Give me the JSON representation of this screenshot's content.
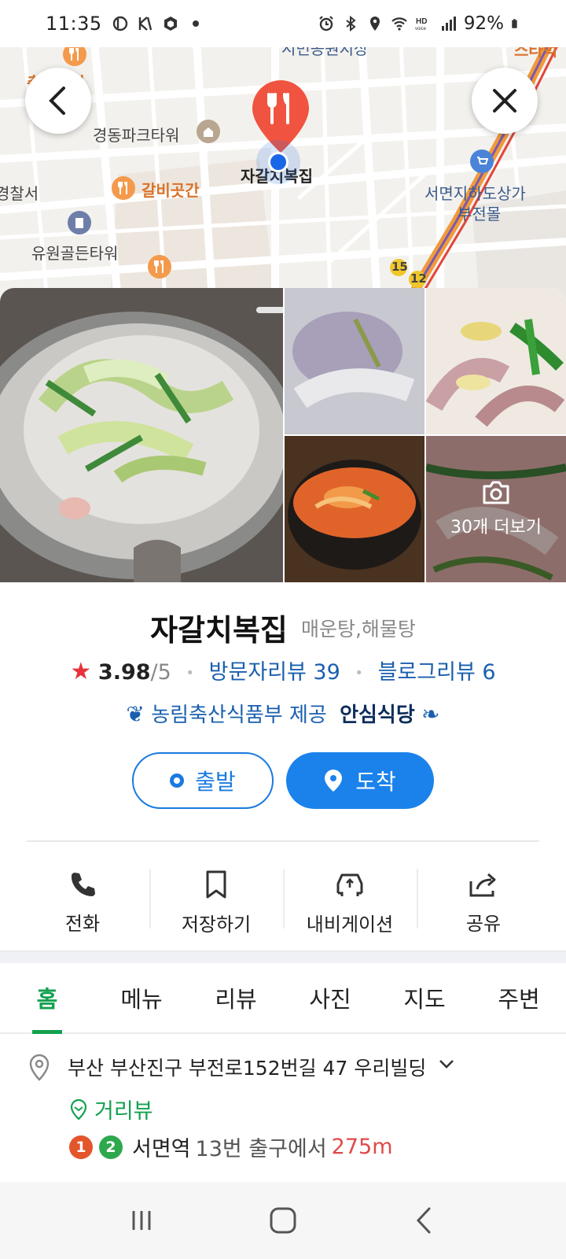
{
  "status_bar": {
    "time": "11:35",
    "battery": "92%",
    "left_icons": [
      "b-app-icon",
      "k-app-icon",
      "cube-app-icon",
      "dot-icon"
    ],
    "right_icons": [
      "alarm-icon",
      "bluetooth-icon",
      "location-icon",
      "wifi-icon",
      "hd-voice-icon",
      "signal-icon",
      "battery-icon"
    ]
  },
  "map": {
    "labels": {
      "top_road": "시민공원지상",
      "noodle": "춘두밀면",
      "park_tower": "경동파크타워",
      "police": "경찰서",
      "galbi": "갈비곳간",
      "yuwon": "유원골든타워",
      "place_label": "자갈치복집",
      "underground": "서면지하도상가",
      "underground2": "부전몰",
      "starbucks": "스타벅",
      "route_15": "15",
      "route_12": "12"
    },
    "back_icon": "chevron-left-icon",
    "close_icon": "close-icon"
  },
  "photos": {
    "more_label": "30개 더보기"
  },
  "place": {
    "name": "자갈치복집",
    "category": "매운탕,해물탕",
    "rating": "3.98",
    "rating_max": "/5",
    "visitor_reviews": "방문자리뷰 39",
    "blog_reviews": "블로그리뷰 6",
    "cert_provider": "농림축산식품부 제공",
    "cert_badge": "안심식당"
  },
  "route": {
    "start_label": "출발",
    "arrive_label": "도착"
  },
  "actions": [
    {
      "label": "전화",
      "icon": "phone-icon"
    },
    {
      "label": "저장하기",
      "icon": "bookmark-icon"
    },
    {
      "label": "내비게이션",
      "icon": "car-navigation-icon"
    },
    {
      "label": "공유",
      "icon": "share-icon"
    }
  ],
  "tabs": [
    "홈",
    "메뉴",
    "리뷰",
    "사진",
    "지도",
    "주변"
  ],
  "active_tab": "홈",
  "details": {
    "address": "부산 부산진구 부전로152번길 47 우리빌딩",
    "street_view": "거리뷰",
    "line1": "1",
    "line2": "2",
    "station": "서면역",
    "exit_info": "13번 출구에서",
    "distance": "275m"
  },
  "colors": {
    "accent_blue": "#1a82ea",
    "link_blue": "#1a5fae",
    "active_green": "#13a14f",
    "star_red": "#e8323c",
    "line1_orange": "#e3552b",
    "line2_green": "#2ea84e"
  }
}
